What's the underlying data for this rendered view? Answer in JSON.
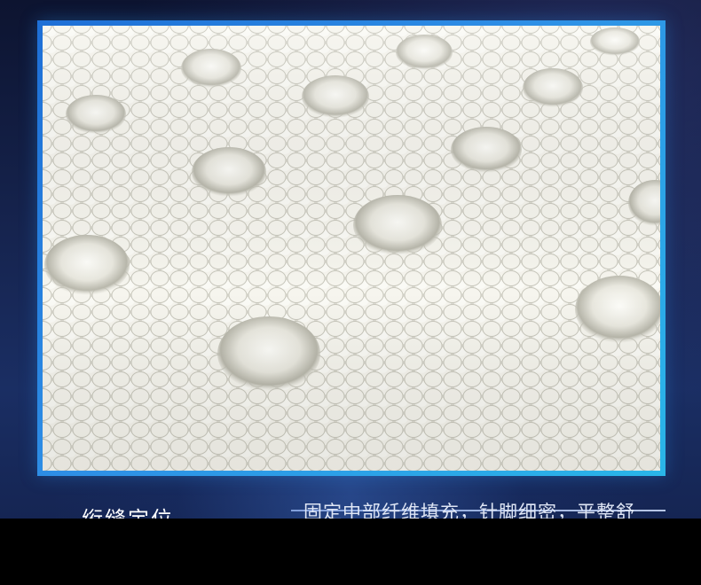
{
  "banner": {
    "image_alt": "mattress quilted knit fabric close-up",
    "caption_left": "绗缝定位",
    "caption_right": "固定中部纤维填充，针脚细密，平整舒"
  },
  "colors": {
    "background_dark": "#0d1430",
    "background_blue": "#1a2e63",
    "frame_blue": "#1e6fd6",
    "frame_cyan": "#2ab6e8",
    "fabric": "#ecebe3"
  }
}
